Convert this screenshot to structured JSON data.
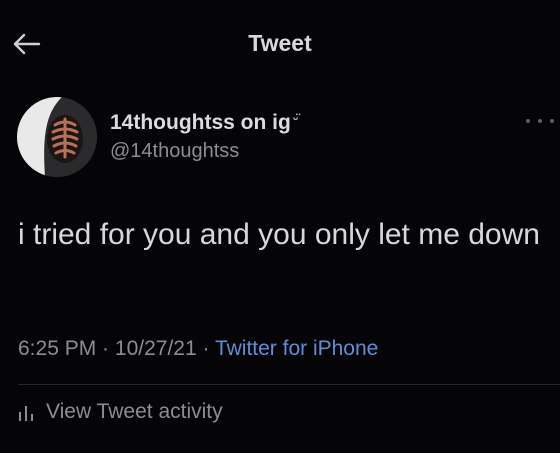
{
  "header": {
    "title": "Tweet",
    "back_icon": "arrow-left-icon"
  },
  "author": {
    "display_name": "14thoughtss on ig",
    "name_emoji": "ᵕ̈",
    "handle": "@14thoughtss",
    "avatar_icon": "profile-photo"
  },
  "tweet": {
    "text": "i tried for you and you only let me down",
    "time": "6:25 PM",
    "separator_1": " · ",
    "date": "10/27/21",
    "separator_2": " · ",
    "source": "Twitter for iPhone"
  },
  "actions": {
    "more_icon": "more-horizontal-icon",
    "activity_label": "View Tweet activity",
    "activity_icon": "analytics-bars-icon"
  },
  "colors": {
    "background": "#050508",
    "text": "#d7d8dc",
    "muted": "#8a8d93",
    "link": "#5d8ed6"
  }
}
